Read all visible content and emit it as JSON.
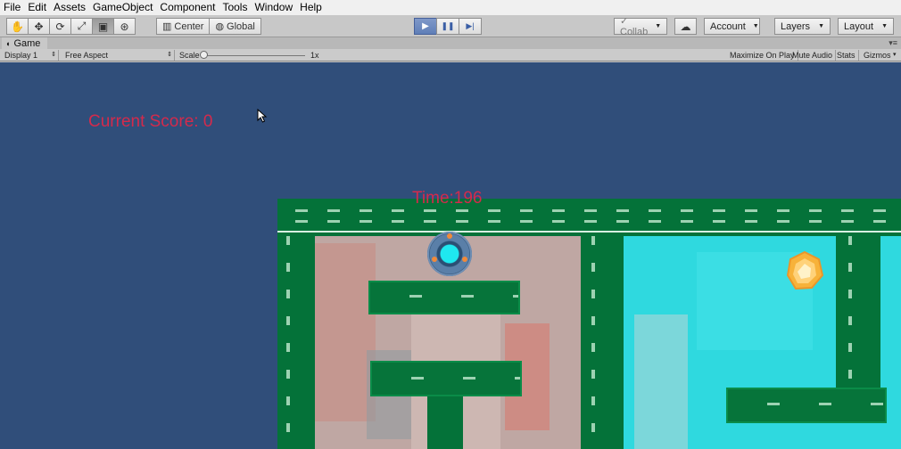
{
  "menu": [
    "File",
    "Edit",
    "Assets",
    "GameObject",
    "Component",
    "Tools",
    "Window",
    "Help"
  ],
  "toolbar": {
    "tools": [
      {
        "name": "hand-tool-icon",
        "glyph": "✋"
      },
      {
        "name": "move-tool-icon",
        "glyph": "✥"
      },
      {
        "name": "rotate-tool-icon",
        "glyph": "⟳"
      },
      {
        "name": "scale-tool-icon",
        "glyph": "⤢"
      },
      {
        "name": "rect-tool-icon",
        "glyph": "▣"
      },
      {
        "name": "transform-tool-icon",
        "glyph": "⊛"
      }
    ],
    "pivot_label": "Center",
    "space_label": "Global",
    "play_glyph": "▶",
    "pause_glyph": "❚❚",
    "step_glyph": "▶|",
    "collab_label": "Collab",
    "cloud_glyph": "☁",
    "account_label": "Account",
    "layers_label": "Layers",
    "layout_label": "Layout"
  },
  "game_tab": {
    "title": "Game",
    "display": "Display 1",
    "aspect": "Free Aspect",
    "scale_label": "Scale",
    "scale_value": "1x",
    "maximize": "Maximize On Play",
    "mute": "Mute Audio",
    "stats": "Stats",
    "gizmos": "Gizmos"
  },
  "hud": {
    "score_text": "Current Score: 0",
    "time_text": "Time:196"
  },
  "colors": {
    "background": "#304e7a",
    "hud_text": "#d42a4c",
    "wall": "#047239",
    "room_right": "#2fd9df"
  }
}
